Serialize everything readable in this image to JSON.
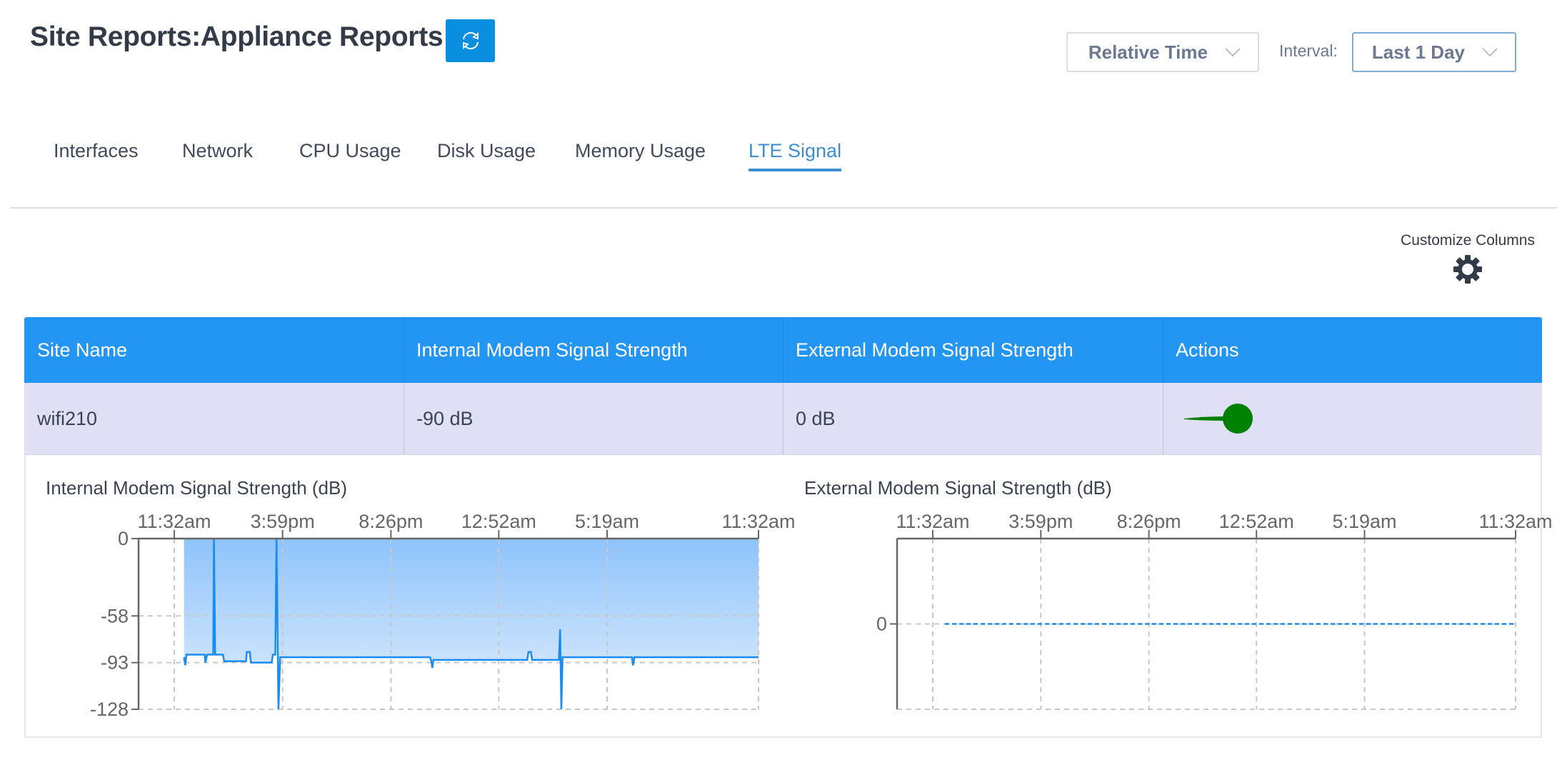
{
  "header": {
    "title": "Site Reports:Appliance Reports",
    "refresh_icon": "refresh-icon",
    "time_mode": {
      "selected": "Relative Time",
      "icon": "chevron-down-icon"
    },
    "interval_label": "Interval:",
    "interval": {
      "selected": "Last 1 Day",
      "icon": "chevron-down-icon"
    }
  },
  "tabs": [
    {
      "label": "Interfaces",
      "active": false
    },
    {
      "label": "Network",
      "active": false
    },
    {
      "label": "CPU Usage",
      "active": false
    },
    {
      "label": "Disk Usage",
      "active": false
    },
    {
      "label": "Memory Usage",
      "active": false
    },
    {
      "label": "LTE Signal",
      "active": true
    }
  ],
  "customize_columns": {
    "label": "Customize Columns",
    "icon": "gear-icon"
  },
  "table": {
    "columns": [
      "Site Name",
      "Internal Modem Signal Strength",
      "External Modem Signal Strength",
      "Actions"
    ],
    "rows": [
      {
        "site_name": "wifi210",
        "internal": "-90 dB",
        "external": "0 dB",
        "action_toggle_on": true
      }
    ]
  },
  "colors": {
    "accent": "#2396f3",
    "button": "#0a8fe0",
    "active_tab": "#3d8ed1",
    "row_bg": "#dfe0f5",
    "toggle_on": "#008000",
    "series": "#1a8cf0"
  },
  "chart_data": [
    {
      "type": "area",
      "title": "Internal Modem Signal Strength (dB)",
      "xlabel": "",
      "ylabel": "dB",
      "x_ticks": [
        "11:32am",
        "3:59pm",
        "8:26pm",
        "12:52am",
        "5:19am",
        "11:32am"
      ],
      "y_ticks": [
        0,
        -58,
        -93,
        -128
      ],
      "ylim": [
        -128,
        0
      ],
      "xlim_hours": [
        -1.6,
        24
      ],
      "x_tick_hours": [
        0,
        4.45,
        8.9,
        13.33,
        17.78,
        24
      ],
      "grid": true,
      "series": [
        {
          "name": "Internal Modem Signal Strength",
          "points": [
            [
              0.4,
              -89
            ],
            [
              0.45,
              -95
            ],
            [
              0.5,
              -87
            ],
            [
              1.25,
              -87
            ],
            [
              1.28,
              -93
            ],
            [
              1.35,
              -87
            ],
            [
              1.6,
              -87
            ],
            [
              1.63,
              0
            ],
            [
              1.68,
              -87
            ],
            [
              2.0,
              -87
            ],
            [
              2.05,
              -92
            ],
            [
              2.95,
              -92
            ],
            [
              2.98,
              -85
            ],
            [
              3.1,
              -85
            ],
            [
              3.15,
              -93
            ],
            [
              4.0,
              -93
            ],
            [
              4.05,
              -87
            ],
            [
              4.15,
              -87
            ],
            [
              4.2,
              0
            ],
            [
              4.28,
              -128
            ],
            [
              4.35,
              -89
            ],
            [
              10.5,
              -89
            ],
            [
              10.55,
              -91
            ],
            [
              10.6,
              -97
            ],
            [
              10.65,
              -91
            ],
            [
              14.5,
              -91
            ],
            [
              14.55,
              -85
            ],
            [
              14.65,
              -85
            ],
            [
              14.7,
              -91
            ],
            [
              15.8,
              -91
            ],
            [
              15.85,
              -68
            ],
            [
              15.9,
              -128
            ],
            [
              15.95,
              -89
            ],
            [
              18.8,
              -89
            ],
            [
              18.85,
              -95
            ],
            [
              18.9,
              -89
            ],
            [
              24,
              -89
            ]
          ]
        }
      ]
    },
    {
      "type": "line",
      "title": "External Modem Signal Strength (dB)",
      "xlabel": "",
      "ylabel": "dB",
      "x_ticks": [
        "11:32am",
        "3:59pm",
        "8:26pm",
        "12:52am",
        "5:19am",
        "11:32am"
      ],
      "y_ticks": [
        0
      ],
      "ylim": [
        -1,
        1
      ],
      "xlim_hours": [
        -1.6,
        24
      ],
      "x_tick_hours": [
        0,
        4.45,
        8.9,
        13.33,
        17.78,
        24
      ],
      "grid": true,
      "series": [
        {
          "name": "External Modem Signal Strength",
          "points": [
            [
              0.5,
              0
            ],
            [
              24,
              0
            ]
          ]
        }
      ]
    }
  ]
}
